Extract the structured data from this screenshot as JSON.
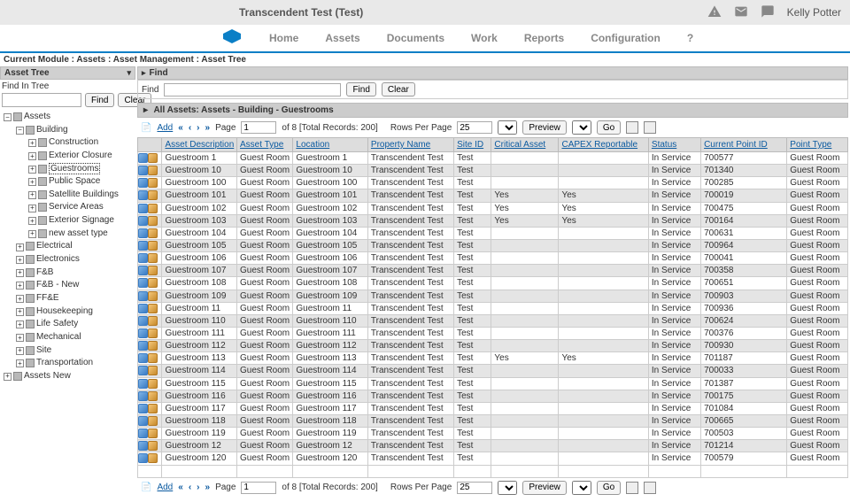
{
  "header": {
    "brand": "Transcendent Test (Test)",
    "user": "Kelly Potter"
  },
  "nav": {
    "items": [
      "Home",
      "Assets",
      "Documents",
      "Work",
      "Reports",
      "Configuration",
      "?"
    ]
  },
  "breadcrumb": "Current Module : Assets : Asset Management : Asset Tree",
  "left_panel": {
    "title": "Asset Tree",
    "find_label": "Find In Tree",
    "find_btn": "Find",
    "clear_btn": "Clear"
  },
  "tree": {
    "root": "Assets",
    "building": "Building",
    "building_children": [
      "Construction",
      "Exterior Closure",
      "Guestrooms",
      "Public Space",
      "Satellite Buildings",
      "Service Areas",
      "Exterior Signage",
      "new asset type"
    ],
    "selected": "Guestrooms",
    "siblings": [
      "Electrical",
      "Electronics",
      "F&B",
      "F&B - New",
      "FF&E",
      "Housekeeping",
      "Life Safety",
      "Mechanical",
      "Site",
      "Transportation"
    ],
    "assets_new": "Assets New"
  },
  "right_panel": {
    "find_title": "Find",
    "find_label": "Find",
    "find_btn": "Find",
    "clear_btn": "Clear",
    "section": "All Assets: Assets - Building - Guestrooms"
  },
  "pager": {
    "add": "Add",
    "page_label": "Page",
    "page": "1",
    "of_label": "of 8  [Total Records: 200]",
    "rows_label": "Rows Per Page",
    "rows": "25",
    "preview": "Preview",
    "go": "Go"
  },
  "columns": [
    "Asset Description",
    "Asset Type",
    "Location",
    "Property Name",
    "Site ID",
    "Critical Asset",
    "CAPEX Reportable",
    "Status",
    "Current Point ID",
    "Point Type"
  ],
  "rows": [
    {
      "desc": "Guestroom 1",
      "type": "Guest Room",
      "loc": "Guestroom 1",
      "prop": "Transcendent Test",
      "site": "Test",
      "crit": "",
      "capex": "",
      "status": "In Service",
      "point": "700577",
      "ptype": "Guest Room"
    },
    {
      "desc": "Guestroom 10",
      "type": "Guest Room",
      "loc": "Guestroom 10",
      "prop": "Transcendent Test",
      "site": "Test",
      "crit": "",
      "capex": "",
      "status": "In Service",
      "point": "701340",
      "ptype": "Guest Room"
    },
    {
      "desc": "Guestroom 100",
      "type": "Guest Room",
      "loc": "Guestroom 100",
      "prop": "Transcendent Test",
      "site": "Test",
      "crit": "",
      "capex": "",
      "status": "In Service",
      "point": "700285",
      "ptype": "Guest Room"
    },
    {
      "desc": "Guestroom 101",
      "type": "Guest Room",
      "loc": "Guestroom 101",
      "prop": "Transcendent Test",
      "site": "Test",
      "crit": "Yes",
      "capex": "Yes",
      "status": "In Service",
      "point": "700019",
      "ptype": "Guest Room"
    },
    {
      "desc": "Guestroom 102",
      "type": "Guest Room",
      "loc": "Guestroom 102",
      "prop": "Transcendent Test",
      "site": "Test",
      "crit": "Yes",
      "capex": "Yes",
      "status": "In Service",
      "point": "700475",
      "ptype": "Guest Room"
    },
    {
      "desc": "Guestroom 103",
      "type": "Guest Room",
      "loc": "Guestroom 103",
      "prop": "Transcendent Test",
      "site": "Test",
      "crit": "Yes",
      "capex": "Yes",
      "status": "In Service",
      "point": "700164",
      "ptype": "Guest Room"
    },
    {
      "desc": "Guestroom 104",
      "type": "Guest Room",
      "loc": "Guestroom 104",
      "prop": "Transcendent Test",
      "site": "Test",
      "crit": "",
      "capex": "",
      "status": "In Service",
      "point": "700631",
      "ptype": "Guest Room"
    },
    {
      "desc": "Guestroom 105",
      "type": "Guest Room",
      "loc": "Guestroom 105",
      "prop": "Transcendent Test",
      "site": "Test",
      "crit": "",
      "capex": "",
      "status": "In Service",
      "point": "700964",
      "ptype": "Guest Room"
    },
    {
      "desc": "Guestroom 106",
      "type": "Guest Room",
      "loc": "Guestroom 106",
      "prop": "Transcendent Test",
      "site": "Test",
      "crit": "",
      "capex": "",
      "status": "In Service",
      "point": "700041",
      "ptype": "Guest Room"
    },
    {
      "desc": "Guestroom 107",
      "type": "Guest Room",
      "loc": "Guestroom 107",
      "prop": "Transcendent Test",
      "site": "Test",
      "crit": "",
      "capex": "",
      "status": "In Service",
      "point": "700358",
      "ptype": "Guest Room"
    },
    {
      "desc": "Guestroom 108",
      "type": "Guest Room",
      "loc": "Guestroom 108",
      "prop": "Transcendent Test",
      "site": "Test",
      "crit": "",
      "capex": "",
      "status": "In Service",
      "point": "700651",
      "ptype": "Guest Room"
    },
    {
      "desc": "Guestroom 109",
      "type": "Guest Room",
      "loc": "Guestroom 109",
      "prop": "Transcendent Test",
      "site": "Test",
      "crit": "",
      "capex": "",
      "status": "In Service",
      "point": "700903",
      "ptype": "Guest Room"
    },
    {
      "desc": "Guestroom 11",
      "type": "Guest Room",
      "loc": "Guestroom 11",
      "prop": "Transcendent Test",
      "site": "Test",
      "crit": "",
      "capex": "",
      "status": "In Service",
      "point": "700936",
      "ptype": "Guest Room"
    },
    {
      "desc": "Guestroom 110",
      "type": "Guest Room",
      "loc": "Guestroom 110",
      "prop": "Transcendent Test",
      "site": "Test",
      "crit": "",
      "capex": "",
      "status": "In Service",
      "point": "700624",
      "ptype": "Guest Room"
    },
    {
      "desc": "Guestroom 111",
      "type": "Guest Room",
      "loc": "Guestroom 111",
      "prop": "Transcendent Test",
      "site": "Test",
      "crit": "",
      "capex": "",
      "status": "In Service",
      "point": "700376",
      "ptype": "Guest Room"
    },
    {
      "desc": "Guestroom 112",
      "type": "Guest Room",
      "loc": "Guestroom 112",
      "prop": "Transcendent Test",
      "site": "Test",
      "crit": "",
      "capex": "",
      "status": "In Service",
      "point": "700930",
      "ptype": "Guest Room"
    },
    {
      "desc": "Guestroom 113",
      "type": "Guest Room",
      "loc": "Guestroom 113",
      "prop": "Transcendent Test",
      "site": "Test",
      "crit": "Yes",
      "capex": "Yes",
      "status": "In Service",
      "point": "701187",
      "ptype": "Guest Room"
    },
    {
      "desc": "Guestroom 114",
      "type": "Guest Room",
      "loc": "Guestroom 114",
      "prop": "Transcendent Test",
      "site": "Test",
      "crit": "",
      "capex": "",
      "status": "In Service",
      "point": "700033",
      "ptype": "Guest Room"
    },
    {
      "desc": "Guestroom 115",
      "type": "Guest Room",
      "loc": "Guestroom 115",
      "prop": "Transcendent Test",
      "site": "Test",
      "crit": "",
      "capex": "",
      "status": "In Service",
      "point": "701387",
      "ptype": "Guest Room"
    },
    {
      "desc": "Guestroom 116",
      "type": "Guest Room",
      "loc": "Guestroom 116",
      "prop": "Transcendent Test",
      "site": "Test",
      "crit": "",
      "capex": "",
      "status": "In Service",
      "point": "700175",
      "ptype": "Guest Room"
    },
    {
      "desc": "Guestroom 117",
      "type": "Guest Room",
      "loc": "Guestroom 117",
      "prop": "Transcendent Test",
      "site": "Test",
      "crit": "",
      "capex": "",
      "status": "In Service",
      "point": "701084",
      "ptype": "Guest Room"
    },
    {
      "desc": "Guestroom 118",
      "type": "Guest Room",
      "loc": "Guestroom 118",
      "prop": "Transcendent Test",
      "site": "Test",
      "crit": "",
      "capex": "",
      "status": "In Service",
      "point": "700665",
      "ptype": "Guest Room"
    },
    {
      "desc": "Guestroom 119",
      "type": "Guest Room",
      "loc": "Guestroom 119",
      "prop": "Transcendent Test",
      "site": "Test",
      "crit": "",
      "capex": "",
      "status": "In Service",
      "point": "700503",
      "ptype": "Guest Room"
    },
    {
      "desc": "Guestroom 12",
      "type": "Guest Room",
      "loc": "Guestroom 12",
      "prop": "Transcendent Test",
      "site": "Test",
      "crit": "",
      "capex": "",
      "status": "In Service",
      "point": "701214",
      "ptype": "Guest Room"
    },
    {
      "desc": "Guestroom 120",
      "type": "Guest Room",
      "loc": "Guestroom 120",
      "prop": "Transcendent Test",
      "site": "Test",
      "crit": "",
      "capex": "",
      "status": "In Service",
      "point": "700579",
      "ptype": "Guest Room"
    }
  ]
}
